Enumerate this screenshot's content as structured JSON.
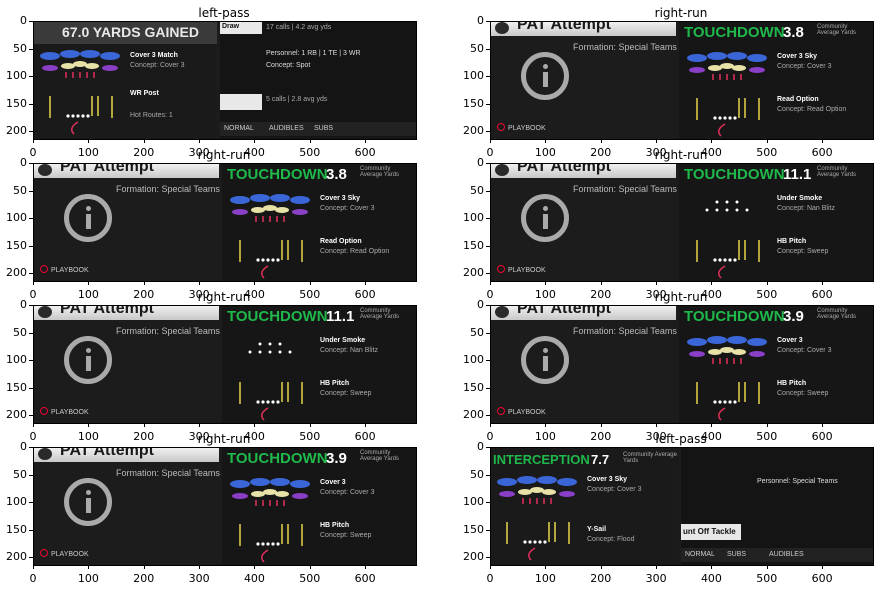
{
  "panels": [
    {
      "title": "left-pass",
      "kind": "pass1",
      "headline": "67.0 YARDS GAINED",
      "coverage": "Cover 3 Match",
      "concept": "Concept: Cover 3",
      "route": "WR Post",
      "hot_routes": "Hot Routes: 1",
      "play_name": "Draw",
      "calls_top": "17 calls | 4.2 avg yds",
      "personnel": "Personnel: 1 RB | 1 TE | 3 WR",
      "concept2": "Concept: Spot",
      "calls_bottom": "5 calls | 2.8 avg yds",
      "footer": [
        "NORMAL",
        "AUDIBLES",
        "SUBS"
      ]
    },
    {
      "title": "right-run",
      "kind": "pat",
      "pat": "PAT Attempt",
      "formation": "Formation: Special Teams",
      "result": "TOUCHDOWN",
      "yards": "3.8",
      "community": "Community Average Yards",
      "coverage": "Cover 3 Sky",
      "concept": "Concept: Cover 3",
      "play": "Read Option",
      "play_concept": "Concept: Read Option",
      "playbook": "PLAYBOOK",
      "defense": "zone"
    },
    {
      "title": "right-run",
      "kind": "pat",
      "pat": "PAT Attempt",
      "formation": "Formation: Special Teams",
      "result": "TOUCHDOWN",
      "yards": "3.8",
      "community": "Community Average Yards",
      "coverage": "Cover 3 Sky",
      "concept": "Concept: Cover 3",
      "play": "Read Option",
      "play_concept": "Concept: Read Option",
      "playbook": "PLAYBOOK",
      "defense": "zone"
    },
    {
      "title": "right-run",
      "kind": "pat",
      "pat": "PAT Attempt",
      "formation": "Formation: Special Teams",
      "result": "TOUCHDOWN",
      "yards": "11.1",
      "community": "Community Average Yards",
      "coverage": "Under Smoke",
      "concept": "Concept: Nan Blitz",
      "play": "HB Pitch",
      "play_concept": "Concept: Sweep",
      "playbook": "PLAYBOOK",
      "defense": "blitz"
    },
    {
      "title": "right-run",
      "kind": "pat",
      "pat": "PAT Attempt",
      "formation": "Formation: Special Teams",
      "result": "TOUCHDOWN",
      "yards": "11.1",
      "community": "Community Average Yards",
      "coverage": "Under Smoke",
      "concept": "Concept: Nan Blitz",
      "play": "HB Pitch",
      "play_concept": "Concept: Sweep",
      "playbook": "PLAYBOOK",
      "defense": "blitz"
    },
    {
      "title": "right-run",
      "kind": "pat",
      "pat": "PAT Attempt",
      "formation": "Formation: Special Teams",
      "result": "TOUCHDOWN",
      "yards": "3.9",
      "community": "Community Average Yards",
      "coverage": "Cover 3",
      "concept": "Concept: Cover 3",
      "play": "HB Pitch",
      "play_concept": "Concept: Sweep",
      "playbook": "PLAYBOOK",
      "defense": "zone"
    },
    {
      "title": "right-run",
      "kind": "pat",
      "pat": "PAT Attempt",
      "formation": "Formation: Special Teams",
      "result": "TOUCHDOWN",
      "yards": "3.9",
      "community": "Community Average Yards",
      "coverage": "Cover 3",
      "concept": "Concept: Cover 3",
      "play": "HB Pitch",
      "play_concept": "Concept: Sweep",
      "playbook": "PLAYBOOK",
      "defense": "zone"
    },
    {
      "title": "left-pass",
      "kind": "pass2",
      "result": "INTERCEPTION",
      "yards": "7.7",
      "community": "Community Average Yards",
      "coverage": "Cover 3 Sky",
      "concept": "Concept: Cover 3",
      "route": "Y-Sail",
      "route_concept": "Concept: Flood",
      "personnel": "Personnel: Special Teams",
      "play_name": "unt Off Tackle",
      "footer": [
        "NORMAL",
        "SUBS",
        "AUDIBLES"
      ]
    }
  ],
  "x_ticks": [
    "0",
    "100",
    "200",
    "300",
    "400",
    "500",
    "600"
  ],
  "y_ticks": [
    "0",
    "50",
    "100",
    "150",
    "200"
  ],
  "colors": {
    "green": "#1fb84a",
    "blue_zone": "#3a66d8",
    "purple_zone": "#8a3fc7",
    "yellow_route": "#e8d44a",
    "red_route": "#e0305a"
  }
}
